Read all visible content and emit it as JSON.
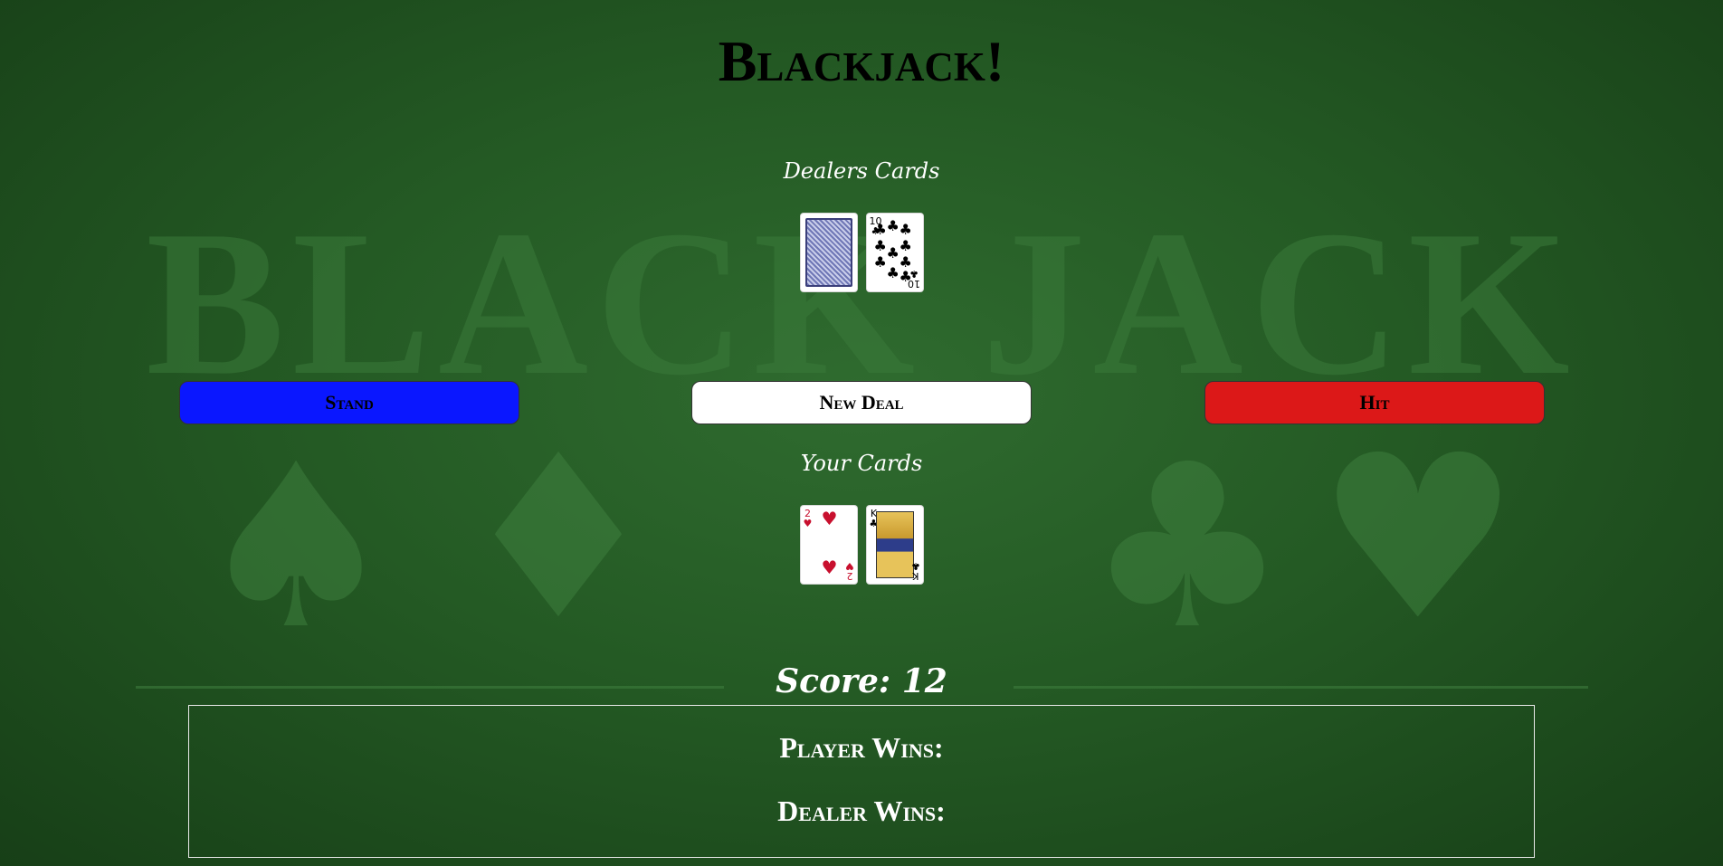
{
  "title": "Blackjack!",
  "background": {
    "watermark_text": "BLACK JACK",
    "suits": [
      "spade-icon",
      "diamond-icon",
      "club-icon",
      "heart-icon"
    ]
  },
  "dealer": {
    "label": "Dealers Cards",
    "cards": [
      {
        "face": "back"
      },
      {
        "rank": "10",
        "suit": "♣",
        "color": "black"
      }
    ]
  },
  "buttons": {
    "stand": "Stand",
    "new_deal": "New Deal",
    "hit": "Hit"
  },
  "player": {
    "label": "Your Cards",
    "cards": [
      {
        "rank": "2",
        "suit": "♥",
        "color": "red"
      },
      {
        "rank": "K",
        "suit": "♣",
        "color": "black"
      }
    ]
  },
  "score": "Score: 12",
  "tally": {
    "player_wins": "Player Wins:",
    "dealer_wins": "Dealer Wins:"
  },
  "colors": {
    "felt": "#245a24",
    "stand": "#0a17ff",
    "deal": "#ffffff",
    "hit": "#dc1818"
  }
}
